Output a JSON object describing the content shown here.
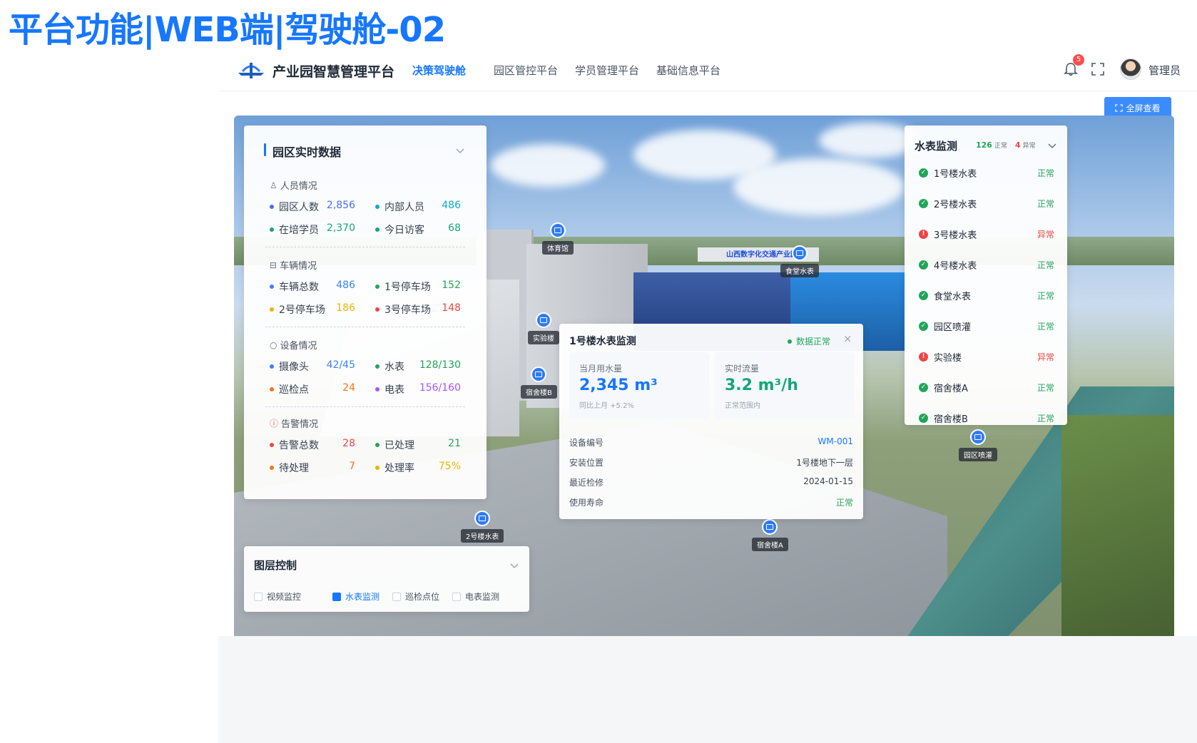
{
  "page_heading": "平台功能|WEB端|驾驶舱-02",
  "header": {
    "brand": "产业园智慧管理平台",
    "tabs": [
      {
        "label": "决策驾驶舱",
        "active": true
      },
      {
        "label": "园区管控平台"
      },
      {
        "label": "学员管理平台"
      },
      {
        "label": "基础信息平台"
      }
    ],
    "notification_count": "5",
    "user_name": "管理员"
  },
  "fullscreen_label": "全屏查看",
  "realtime": {
    "title": "园区实时数据",
    "sections": [
      {
        "label": "人员情况",
        "stats": [
          {
            "label": "园区人数",
            "value": "2,856",
            "color": "#4f6bed"
          },
          {
            "label": "内部人员",
            "value": "486",
            "color": "#13a8c2"
          },
          {
            "label": "在培学员",
            "value": "2,370",
            "color": "#15a67a"
          },
          {
            "label": "今日访客",
            "value": "68",
            "color": "#15a67a"
          }
        ]
      },
      {
        "label": "车辆情况",
        "stats": [
          {
            "label": "车辆总数",
            "value": "486",
            "color": "#3b82f6"
          },
          {
            "label": "1号停车场",
            "value": "152",
            "color": "#22a55a"
          },
          {
            "label": "2号停车场",
            "value": "186",
            "color": "#eab308"
          },
          {
            "label": "3号停车场",
            "value": "148",
            "color": "#ef4444"
          }
        ]
      },
      {
        "label": "设备情况",
        "stats": [
          {
            "label": "摄像头",
            "value": "42/45",
            "color": "#3b82f6"
          },
          {
            "label": "水表",
            "value": "128/130",
            "color": "#22a55a"
          },
          {
            "label": "巡检点",
            "value": "24",
            "color": "#f97316"
          },
          {
            "label": "电表",
            "value": "156/160",
            "color": "#a855f7"
          }
        ]
      },
      {
        "label": "告警情况",
        "stats": [
          {
            "label": "告警总数",
            "value": "28",
            "color": "#ef4444"
          },
          {
            "label": "已处理",
            "value": "21",
            "color": "#22a55a"
          },
          {
            "label": "待处理",
            "value": "7",
            "color": "#f97316"
          },
          {
            "label": "处理率",
            "value": "75%",
            "color": "#eab308"
          }
        ]
      }
    ]
  },
  "water_monitor": {
    "title": "水表监测",
    "normal_count": "126",
    "normal_label": "正常",
    "abnormal_count": "4",
    "abnormal_label": "异常",
    "items": [
      {
        "name": "1号楼水表",
        "status": "正常",
        "ok": true
      },
      {
        "name": "2号楼水表",
        "status": "正常",
        "ok": true
      },
      {
        "name": "3号楼水表",
        "status": "异常",
        "ok": false
      },
      {
        "name": "4号楼水表",
        "status": "正常",
        "ok": true
      },
      {
        "name": "食堂水表",
        "status": "正常",
        "ok": true
      },
      {
        "name": "园区喷灌",
        "status": "正常",
        "ok": true
      },
      {
        "name": "实验楼",
        "status": "异常",
        "ok": false
      },
      {
        "name": "宿舍楼A",
        "status": "正常",
        "ok": true
      },
      {
        "name": "宿舍楼B",
        "status": "正常",
        "ok": true
      }
    ]
  },
  "popup": {
    "title": "1号楼水表监测",
    "status": "数据正常",
    "monthly": {
      "label": "当月用水量",
      "value": "2,345 m³",
      "sub": "同比上月 +5.2%"
    },
    "flow": {
      "label": "实时流量",
      "value": "3.2 m³/h",
      "sub": "正常范围内"
    },
    "rows": [
      {
        "label": "设备编号",
        "value": "WM-001"
      },
      {
        "label": "安装位置",
        "value": "1号楼地下一层"
      },
      {
        "label": "最近检修",
        "value": "2024-01-15"
      },
      {
        "label": "使用寿命",
        "value": "正常"
      }
    ]
  },
  "layers": {
    "title": "图层控制",
    "options": [
      {
        "label": "视频监控",
        "checked": false
      },
      {
        "label": "水表监测",
        "checked": true
      },
      {
        "label": "巡检点位",
        "checked": false
      },
      {
        "label": "电表监测",
        "checked": false
      }
    ]
  },
  "map_markers": [
    "体育馆",
    "食堂水表",
    "实验楼",
    "宿舍楼B",
    "2号楼水表",
    "宿舍楼A",
    "园区喷灌"
  ],
  "building_sign": "山西数字化交通产业园",
  "colors": {
    "accent": "#1677ff",
    "normal": "#22a55a",
    "abnormal": "#ef4444"
  }
}
